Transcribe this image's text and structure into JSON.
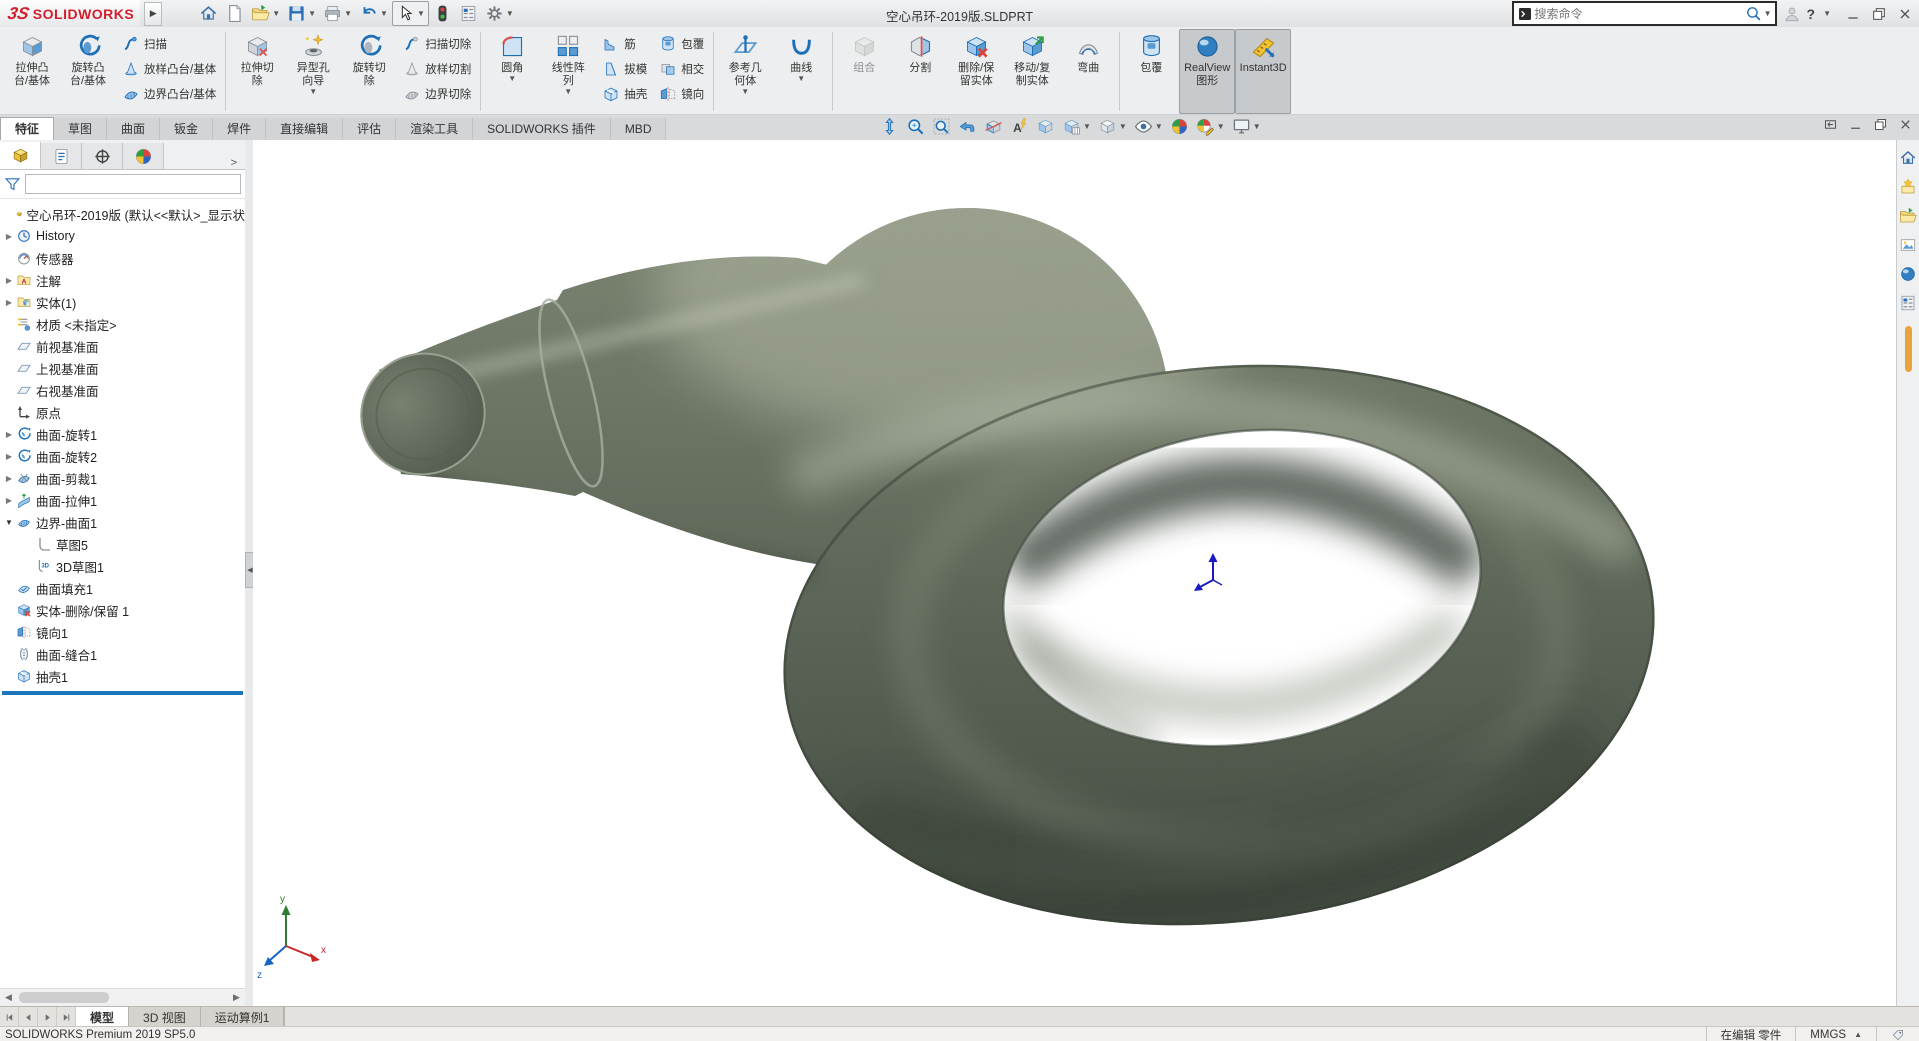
{
  "window": {
    "brand": "SOLIDWORKS",
    "title": "空心吊环-2019版.SLDPRT",
    "search_placeholder": "搜索命令",
    "help_label": "?"
  },
  "quick_access": [
    {
      "id": "home",
      "icon": "home"
    },
    {
      "id": "new-document",
      "icon": "new-doc"
    },
    {
      "id": "open",
      "icon": "open",
      "caret": true
    },
    {
      "id": "save",
      "icon": "save",
      "caret": true
    },
    {
      "id": "print",
      "icon": "print",
      "caret": true
    },
    {
      "id": "undo",
      "icon": "undo",
      "caret": true
    },
    {
      "id": "select",
      "icon": "select-cursor",
      "caret": true,
      "boxed": true
    },
    {
      "id": "rebuild",
      "icon": "rebuild"
    },
    {
      "id": "file-properties",
      "icon": "options-list"
    },
    {
      "id": "options",
      "icon": "settings-gear",
      "caret": true
    }
  ],
  "ribbon": {
    "items": [
      {
        "type": "large",
        "id": "extruded-boss",
        "icon": "boss-extrude",
        "lines": [
          "拉伸凸",
          "台/基体"
        ]
      },
      {
        "type": "large",
        "id": "revolved-boss",
        "icon": "revolve",
        "lines": [
          "旋转凸",
          "台/基体"
        ]
      },
      {
        "type": "stack",
        "items": [
          {
            "id": "swept-boss",
            "icon": "sweep",
            "label": "扫描"
          },
          {
            "id": "lofted-boss",
            "icon": "loft",
            "label": "放样凸台/基体"
          },
          {
            "id": "boundary-boss",
            "icon": "boundary",
            "label": "边界凸台/基体"
          }
        ]
      },
      {
        "type": "sep"
      },
      {
        "type": "large",
        "id": "extruded-cut",
        "icon": "cut-extrude",
        "lines": [
          "拉伸切",
          "除"
        ]
      },
      {
        "type": "large",
        "id": "hole-wizard",
        "icon": "hole-wizard",
        "lines": [
          "异型孔",
          "向导"
        ],
        "caret": true
      },
      {
        "type": "large",
        "id": "revolved-cut",
        "icon": "cut-revolve",
        "lines": [
          "旋转切",
          "除"
        ]
      },
      {
        "type": "stack",
        "items": [
          {
            "id": "swept-cut",
            "icon": "cut-sweep",
            "label": "扫描切除"
          },
          {
            "id": "lofted-cut",
            "icon": "cut-loft",
            "label": "放样切割"
          },
          {
            "id": "boundary-cut",
            "icon": "cut-boundary",
            "label": "边界切除"
          }
        ]
      },
      {
        "type": "sep"
      },
      {
        "type": "large",
        "id": "fillet",
        "icon": "fillet",
        "lines": [
          "圆角"
        ],
        "caret": true
      },
      {
        "type": "large",
        "id": "linear-pattern",
        "icon": "pattern",
        "lines": [
          "线性阵",
          "列"
        ],
        "caret": true
      },
      {
        "type": "stack",
        "items": [
          {
            "id": "rib",
            "icon": "rib",
            "label": "筋"
          },
          {
            "id": "draft",
            "icon": "draft",
            "label": "拔模"
          },
          {
            "id": "shell",
            "icon": "shell",
            "label": "抽壳"
          }
        ]
      },
      {
        "type": "stack",
        "items": [
          {
            "id": "wrap",
            "icon": "wrap",
            "label": "包覆"
          },
          {
            "id": "intersect",
            "icon": "intersect",
            "label": "相交"
          },
          {
            "id": "mirror",
            "icon": "mirror",
            "label": "镜向"
          }
        ]
      },
      {
        "type": "sep"
      },
      {
        "type": "large",
        "id": "reference-geometry",
        "icon": "ref-geometry",
        "lines": [
          "参考几",
          "何体"
        ],
        "caret": true
      },
      {
        "type": "large",
        "id": "curves",
        "icon": "curve",
        "lines": [
          "曲线"
        ],
        "caret": true
      },
      {
        "type": "sep"
      },
      {
        "type": "large",
        "id": "combine",
        "icon": "combine",
        "lines": [
          "组合"
        ],
        "disabled": true
      },
      {
        "type": "large",
        "id": "split",
        "icon": "split",
        "lines": [
          "分割"
        ]
      },
      {
        "type": "large",
        "id": "delete-keep-body",
        "icon": "delete-body",
        "lines": [
          "删除/保",
          "留实体"
        ]
      },
      {
        "type": "large",
        "id": "move-copy-body",
        "icon": "move-copy",
        "lines": [
          "移动/复",
          "制实体"
        ]
      },
      {
        "type": "large",
        "id": "flex",
        "icon": "flex",
        "lines": [
          "弯曲"
        ]
      },
      {
        "type": "sep"
      },
      {
        "type": "large",
        "id": "wrap-2",
        "icon": "wrap",
        "lines": [
          "包覆"
        ]
      },
      {
        "type": "large",
        "id": "realview-graphics",
        "icon": "realview",
        "lines": [
          "RealView",
          "图形"
        ],
        "pressed": true
      },
      {
        "type": "large",
        "id": "instant3d",
        "icon": "instant3d",
        "lines": [
          "Instant3D"
        ],
        "pressed": true
      }
    ]
  },
  "tabs": {
    "items": [
      {
        "id": "features",
        "label": "特征",
        "active": true
      },
      {
        "id": "sketch",
        "label": "草图"
      },
      {
        "id": "surfaces",
        "label": "曲面"
      },
      {
        "id": "sheet-metal",
        "label": "钣金"
      },
      {
        "id": "weldments",
        "label": "焊件"
      },
      {
        "id": "direct-editing",
        "label": "直接编辑"
      },
      {
        "id": "evaluate",
        "label": "评估"
      },
      {
        "id": "render-tools",
        "label": "渲染工具"
      },
      {
        "id": "solidworks-addins",
        "label": "SOLIDWORKS 插件"
      },
      {
        "id": "mbd",
        "label": "MBD"
      }
    ]
  },
  "headsup": {
    "items": [
      {
        "id": "zoom-in-out",
        "icon": "arrow-updown"
      },
      {
        "id": "zoom-to-fit",
        "icon": "mag-fit"
      },
      {
        "id": "zoom-to-area",
        "icon": "mag-area"
      },
      {
        "id": "previous-view",
        "icon": "prev-view"
      },
      {
        "id": "section-view",
        "icon": "section-view"
      },
      {
        "id": "annotation-views",
        "icon": "annotation-views"
      },
      {
        "id": "view-orientation",
        "icon": "view-cube"
      },
      {
        "id": "display-style",
        "icon": "display-style",
        "caret": true
      },
      {
        "id": "display-style-alt",
        "icon": "view-cube2",
        "caret": true
      },
      {
        "id": "hide-show-items",
        "icon": "eye",
        "caret": true
      },
      {
        "id": "edit-appearance",
        "icon": "colorwheel"
      },
      {
        "id": "apply-scene",
        "icon": "colorwheel-pencil",
        "caret": true
      },
      {
        "id": "view-settings",
        "icon": "monitor",
        "caret": true
      }
    ]
  },
  "doc_window_buttons": [
    {
      "id": "dock",
      "icon": "dock"
    },
    {
      "id": "minimize",
      "icon": "minimize"
    },
    {
      "id": "restore",
      "icon": "restore"
    },
    {
      "id": "close",
      "icon": "close"
    }
  ],
  "feature_tree": {
    "manager_tabs": [
      {
        "id": "feature-manager",
        "icon": "part-yellow",
        "active": true
      },
      {
        "id": "property-manager",
        "icon": "clipboard"
      },
      {
        "id": "configuration-manager",
        "icon": "config-target"
      },
      {
        "id": "display-manager",
        "icon": "colorwheel"
      }
    ],
    "expand_label": ">",
    "items": [
      {
        "id": "part-root",
        "icon": "part-yellow",
        "label": "空心吊环-2019版 (默认<<默认>_显示状"
      },
      {
        "id": "history",
        "icon": "history",
        "label": "History",
        "expander": "collapsed"
      },
      {
        "id": "sensors",
        "icon": "sensors",
        "label": "传感器"
      },
      {
        "id": "annotations",
        "icon": "annotations",
        "label": "注解",
        "expander": "collapsed"
      },
      {
        "id": "solid-bodies",
        "icon": "solids",
        "label": "实体(1)",
        "expander": "collapsed"
      },
      {
        "id": "material",
        "icon": "material",
        "label": "材质 <未指定>"
      },
      {
        "id": "front-plane",
        "icon": "plane",
        "label": "前视基准面"
      },
      {
        "id": "top-plane",
        "icon": "plane",
        "label": "上视基准面"
      },
      {
        "id": "right-plane",
        "icon": "plane",
        "label": "右视基准面"
      },
      {
        "id": "origin",
        "icon": "origin",
        "label": "原点"
      },
      {
        "id": "surface-revolve1",
        "icon": "surf-revolve",
        "label": "曲面-旋转1",
        "expander": "collapsed"
      },
      {
        "id": "surface-revolve2",
        "icon": "surf-revolve",
        "label": "曲面-旋转2",
        "expander": "collapsed"
      },
      {
        "id": "surface-trim1",
        "icon": "surf-trim",
        "label": "曲面-剪裁1",
        "expander": "collapsed"
      },
      {
        "id": "surface-extrude1",
        "icon": "surf-extrude",
        "label": "曲面-拉伸1",
        "expander": "collapsed"
      },
      {
        "id": "boundary-surface1",
        "icon": "boundary-surface",
        "label": "边界-曲面1",
        "expander": "expanded"
      },
      {
        "id": "sketch5",
        "icon": "sketch",
        "label": "草图5",
        "indent": 1
      },
      {
        "id": "sketch3d1",
        "icon": "sketch3d",
        "label": "3D草图1",
        "indent": 1
      },
      {
        "id": "surface-fill1",
        "icon": "surf-fill",
        "label": "曲面填充1"
      },
      {
        "id": "body-delete-keep1",
        "icon": "delete-body",
        "label": "实体-删除/保留 1"
      },
      {
        "id": "mirror1",
        "icon": "mirror",
        "label": "镜向1"
      },
      {
        "id": "surface-knit1",
        "icon": "surf-knit",
        "label": "曲面-缝合1"
      },
      {
        "id": "shell1",
        "icon": "shell",
        "label": "抽壳1"
      }
    ]
  },
  "task_pane": {
    "icons": [
      {
        "id": "home",
        "icon": "home"
      },
      {
        "id": "design-library",
        "icon": "design-library"
      },
      {
        "id": "file-explorer",
        "icon": "open"
      },
      {
        "id": "view-palette",
        "icon": "view-palette"
      },
      {
        "id": "appearances-scenes",
        "icon": "realview"
      },
      {
        "id": "custom-properties",
        "icon": "options-list"
      }
    ]
  },
  "viewport": {
    "model_name": "空心吊环",
    "body_color": "#636b5c",
    "body_light": "#828a77",
    "body_dark": "#3d453c",
    "highlight_color": "#b7bead",
    "background": "#ffffff",
    "triad_color": "#1a1ac2"
  },
  "bottom_tabs": {
    "items": [
      {
        "id": "model",
        "label": "模型",
        "active": true
      },
      {
        "id": "3d-views",
        "label": "3D 视图"
      },
      {
        "id": "motion-study-1",
        "label": "运动算例1"
      }
    ]
  },
  "status_bar": {
    "left": "SOLIDWORKS Premium 2019 SP5.0",
    "editing_label": "在编辑 零件",
    "units_label": "MMGS"
  }
}
